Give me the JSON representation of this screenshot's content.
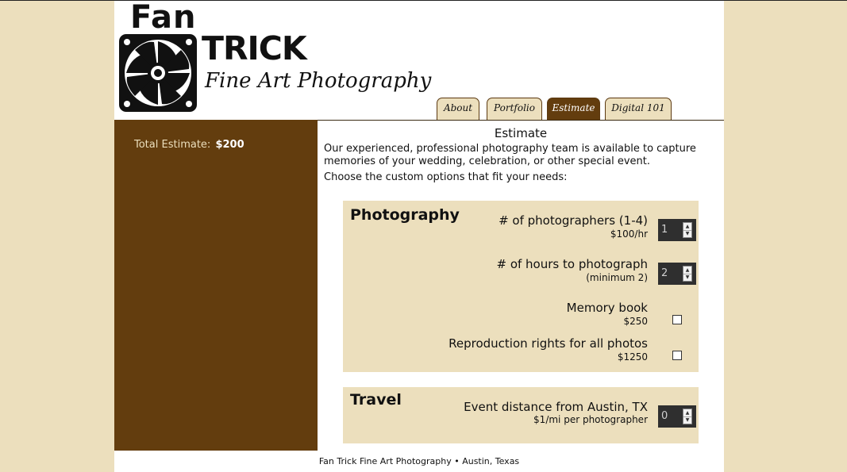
{
  "logo": {
    "line1": "Fan",
    "line2": "TRICK",
    "line3": "Fine Art Photography"
  },
  "nav": {
    "tabs": [
      {
        "label": "About",
        "active": false
      },
      {
        "label": "Portfolio",
        "active": false
      },
      {
        "label": "Estimate",
        "active": true
      },
      {
        "label": "Digital 101",
        "active": false
      }
    ]
  },
  "sidebar": {
    "total_label": "Total Estimate:",
    "total_value": "$200"
  },
  "main": {
    "title": "Estimate",
    "intro": "Our experienced, professional photography team is available to capture memories of your wedding, celebration, or other special event.",
    "choose": "Choose the custom options that fit your needs:"
  },
  "photography": {
    "title": "Photography",
    "photographers": {
      "label": "# of photographers (1-4)",
      "sub": "$100/hr",
      "value": "1"
    },
    "hours": {
      "label": "# of hours to photograph",
      "sub": "(minimum 2)",
      "value": "2"
    },
    "memory_book": {
      "label": "Memory book",
      "sub": "$250",
      "checked": false
    },
    "reproduction": {
      "label": "Reproduction rights for all photos",
      "sub": "$1250",
      "checked": false
    }
  },
  "travel": {
    "title": "Travel",
    "distance": {
      "label": "Event distance from Austin, TX",
      "sub": "$1/mi per photographer",
      "value": "0"
    }
  },
  "footer": {
    "text": "Fan Trick Fine Art Photography • Austin, Texas"
  },
  "colors": {
    "background": "#ecdfbd",
    "brown": "#633d0e",
    "panel": "#ecdfbd"
  },
  "icons": {
    "logo": "camera-fan-icon",
    "spinner_up": "arrow-up-icon",
    "spinner_down": "arrow-down-icon"
  }
}
